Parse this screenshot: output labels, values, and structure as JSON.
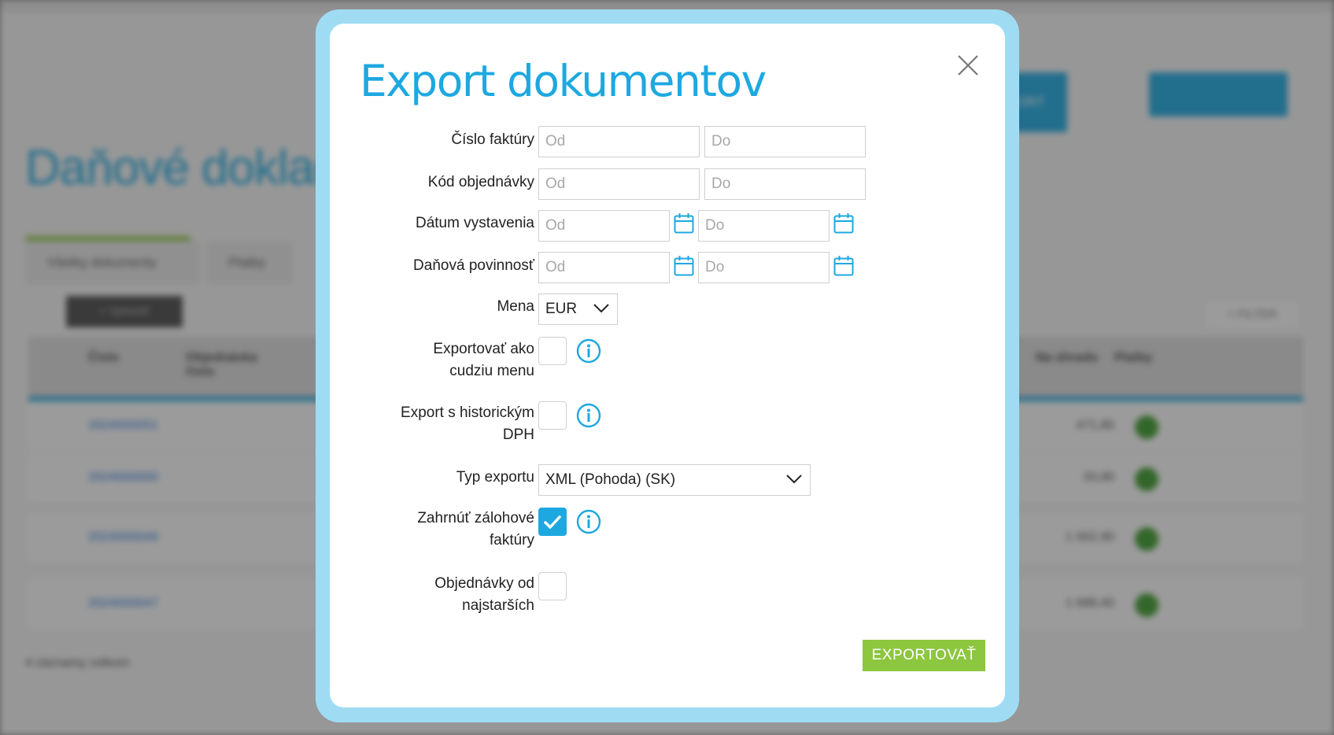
{
  "modal": {
    "title": "Export dokumentov",
    "close_icon": "close-icon"
  },
  "fields": {
    "invoice_number": {
      "label": "Číslo faktúry",
      "from_placeholder": "Od",
      "to_placeholder": "Do"
    },
    "order_code": {
      "label": "Kód objednávky",
      "from_placeholder": "Od",
      "to_placeholder": "Do"
    },
    "issue_date": {
      "label": "Dátum vystavenia",
      "from_placeholder": "Od",
      "to_placeholder": "Do",
      "icon": "calendar-icon"
    },
    "tax_liability": {
      "label": "Daňová povinnosť",
      "from_placeholder": "Od",
      "to_placeholder": "Do",
      "icon": "calendar-icon"
    },
    "currency": {
      "label": "Mena",
      "value": "EUR"
    },
    "export_foreign_currency": {
      "label_line1": "Exportovať ako",
      "label_line2": "cudziu menu",
      "checked": false
    },
    "export_historic_vat": {
      "label_line1": "Export s historickým",
      "label_line2": "DPH",
      "checked": false
    },
    "export_type": {
      "label": "Typ exportu",
      "value": "XML (Pohoda) (SK)"
    },
    "include_advance_invoices": {
      "label_line1": "Zahrnúť zálohové",
      "label_line2": "faktúry",
      "checked": true
    },
    "orders_oldest_first": {
      "label_line1": "Objednávky od",
      "label_line2": "najstarších",
      "checked": false
    }
  },
  "actions": {
    "export_label": "EXPORTOVAŤ"
  },
  "colors": {
    "accent": "#1ea8e0",
    "modal_frame": "#9fdcf4",
    "export_button": "#8dc63f",
    "background_title": "#1ea8e0"
  },
  "background": {
    "title": "Daňové doklady",
    "tab_all": "Všetky dokumenty",
    "tab_payments": "Platby",
    "create_button": "+ Vytvoriť",
    "filter_button": "+ FILTER",
    "export_button": "EXPORT",
    "col_number": "Číslo",
    "col_order_code": "Objednávka číslo",
    "col_amount": "Na úhradu",
    "col_paid": "Platby",
    "rows": [
      {
        "number": "2024000051",
        "amount": "471,80"
      },
      {
        "number": "2024000050",
        "amount": "33,90"
      },
      {
        "number": "2024000049",
        "amount": "1 002,90"
      },
      {
        "number": "2024000047",
        "amount": "1 688,40"
      }
    ],
    "footer": "4 záznamy celkom"
  }
}
